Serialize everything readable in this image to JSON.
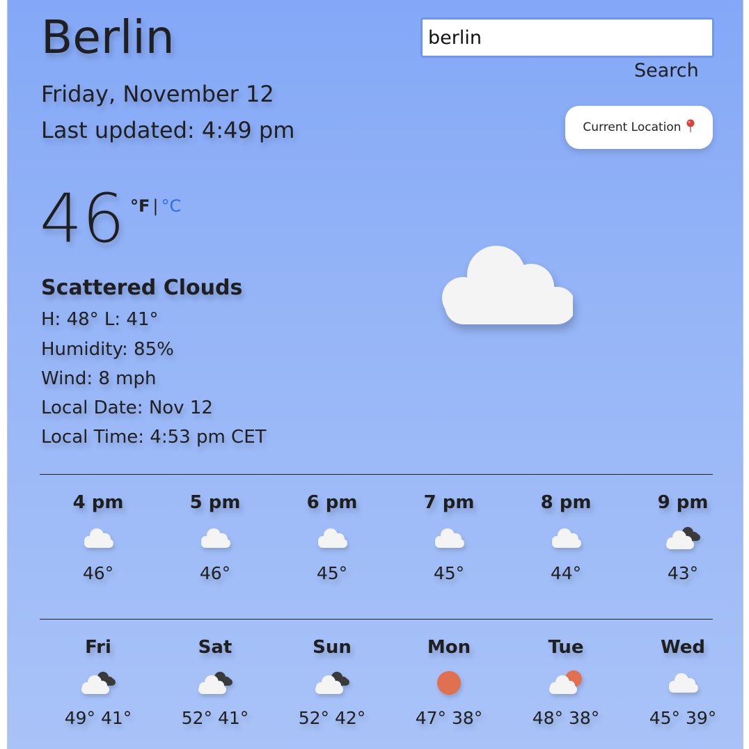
{
  "header": {
    "city": "Berlin",
    "date": "Friday, November 12",
    "last_updated": "Last updated: 4:49 pm"
  },
  "search": {
    "value": "berlin",
    "button_label": "Search"
  },
  "location_button": {
    "label": "Current Location",
    "icon": "pin-icon"
  },
  "current": {
    "temperature": "46",
    "unit_f": "°F",
    "unit_separator": "|",
    "unit_c": "°C",
    "icon": "cloud-icon",
    "description": "Scattered Clouds",
    "high_low": "H: 48° L: 41°",
    "humidity": "Humidity: 85%",
    "wind": "Wind: 8 mph",
    "local_date": "Local Date: Nov 12",
    "local_time": "Local Time: 4:53 pm CET"
  },
  "hourly": [
    {
      "label": "4 pm",
      "icon": "cloud-icon",
      "temp": "46°"
    },
    {
      "label": "5 pm",
      "icon": "cloud-icon",
      "temp": "46°"
    },
    {
      "label": "6 pm",
      "icon": "cloud-icon",
      "temp": "45°"
    },
    {
      "label": "7 pm",
      "icon": "cloud-icon",
      "temp": "45°"
    },
    {
      "label": "8 pm",
      "icon": "cloud-icon",
      "temp": "44°"
    },
    {
      "label": "9 pm",
      "icon": "broken-clouds-icon",
      "temp": "43°"
    }
  ],
  "daily": [
    {
      "label": "Fri",
      "icon": "broken-clouds-icon",
      "temp": "49° 41°"
    },
    {
      "label": "Sat",
      "icon": "broken-clouds-icon",
      "temp": "52° 41°"
    },
    {
      "label": "Sun",
      "icon": "broken-clouds-icon",
      "temp": "52° 42°"
    },
    {
      "label": "Mon",
      "icon": "sun-icon",
      "temp": "47° 38°"
    },
    {
      "label": "Tue",
      "icon": "sun-cloud-icon",
      "temp": "48° 38°"
    },
    {
      "label": "Wed",
      "icon": "cloud-icon",
      "temp": "45° 39°"
    }
  ],
  "colors": {
    "sun": "#e0704f",
    "cloud": "#f4f4f4",
    "dark_cloud": "#3a3a3a",
    "link": "#2f6df0",
    "input_border": "#6f95f2"
  }
}
